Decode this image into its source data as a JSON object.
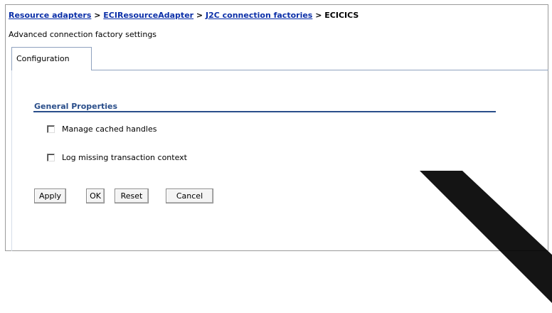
{
  "breadcrumb": {
    "link1": "Resource adapters",
    "sep1": ">",
    "link2": "ECIResourceAdapter",
    "sep2": ">",
    "link3": "J2C connection factories",
    "sep3": ">",
    "current": "ECICICS"
  },
  "subtitle": "Advanced connection factory settings",
  "tabs": [
    {
      "label": "Configuration",
      "selected": true
    }
  ],
  "section": {
    "title": "General Properties"
  },
  "checkboxes": [
    {
      "label": "Manage cached handles",
      "checked": false
    },
    {
      "label": "Log missing transaction context",
      "checked": false
    }
  ],
  "buttons": {
    "apply": "Apply",
    "ok": "OK",
    "reset": "Reset",
    "cancel": "Cancel"
  },
  "colors": {
    "link": "#0b2fa8",
    "section_title": "#2a4e8a",
    "tab_border": "#8fa2bf"
  }
}
